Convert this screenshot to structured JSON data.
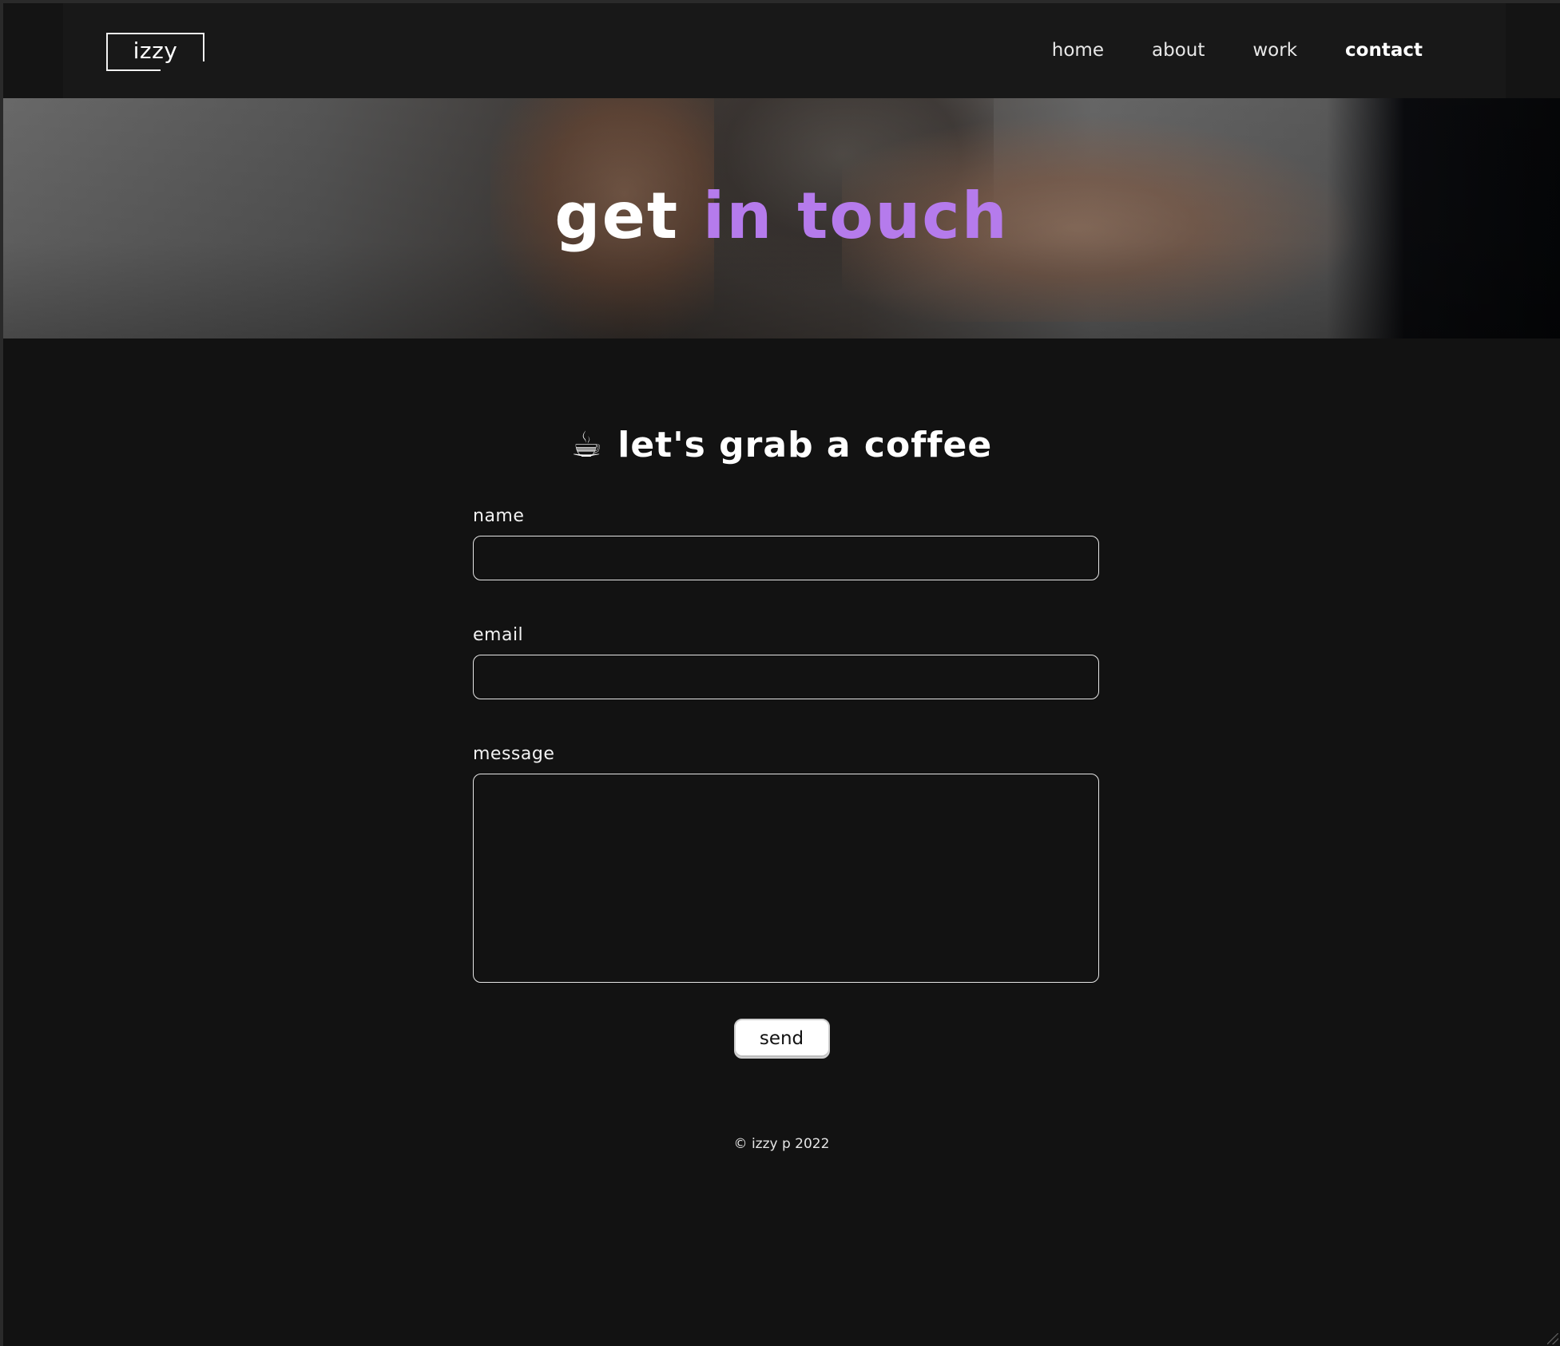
{
  "nav": {
    "logo": "izzy",
    "links": [
      {
        "label": "home"
      },
      {
        "label": "about"
      },
      {
        "label": "work"
      },
      {
        "label": "contact",
        "active": true
      }
    ]
  },
  "hero": {
    "title_white": "get",
    "title_purple": "in touch"
  },
  "main": {
    "heading": "let's grab a coffee",
    "heading_icon": "☕"
  },
  "form": {
    "name_label": "name",
    "name_value": "",
    "email_label": "email",
    "email_value": "",
    "message_label": "message",
    "message_value": "",
    "send_label": "send"
  },
  "footer": {
    "text": "© izzy p 2022"
  },
  "colors": {
    "accent": "#b57bec",
    "background": "#121212",
    "nav_background": "#181818"
  }
}
